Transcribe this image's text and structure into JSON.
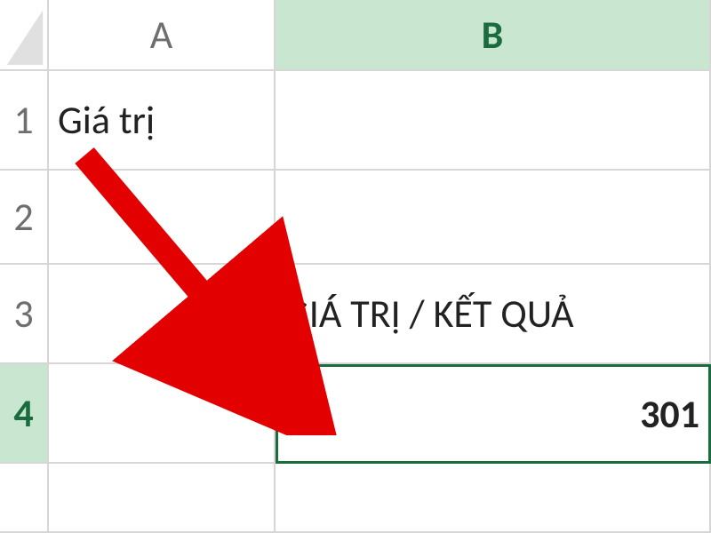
{
  "columns": {
    "A": "A",
    "B": "B"
  },
  "rows": {
    "1": "1",
    "2": "2",
    "3": "3",
    "4": "4"
  },
  "cells": {
    "A1": "Giá trị",
    "A2": "",
    "A3": "",
    "A4": "",
    "B1": "",
    "B2": "",
    "B3": "GIÁ TRỊ / KẾT QUẢ",
    "B4": "301"
  },
  "active_cell": "B4",
  "annotation": {
    "arrow_color": "#e30000"
  }
}
